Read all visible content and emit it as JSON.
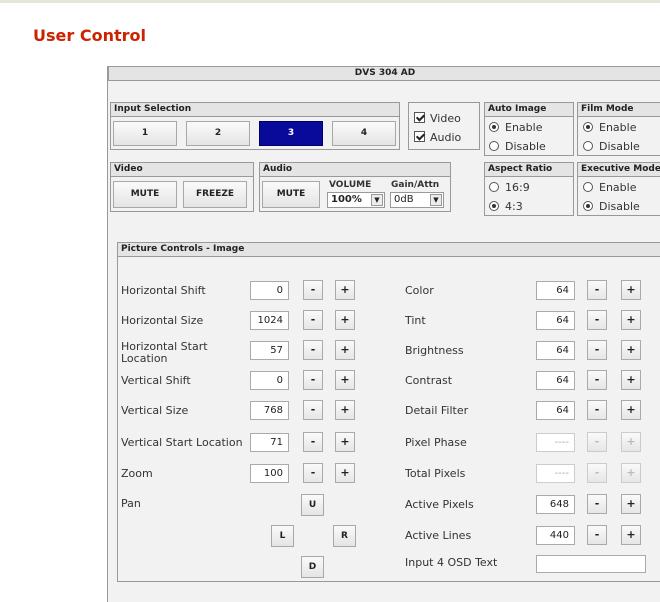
{
  "page_title": "User Control",
  "device_title": "DVS 304 AD",
  "input_selection": {
    "label": "Input Selection",
    "buttons": [
      "1",
      "2",
      "3",
      "4"
    ],
    "selected": "3",
    "video_label": "Video",
    "video_checked": true,
    "audio_label": "Audio",
    "audio_checked": true
  },
  "auto_image": {
    "label": "Auto Image",
    "enable": "Enable",
    "disable": "Disable",
    "value": "Enable"
  },
  "film_mode": {
    "label": "Film Mode",
    "enable": "Enable",
    "disable": "Disable",
    "value": "Enable"
  },
  "aspect_ratio": {
    "label": "Aspect Ratio",
    "opt1": "16:9",
    "opt2": "4:3",
    "value": "4:3"
  },
  "executive_mode": {
    "label": "Executive Mode",
    "enable": "Enable",
    "disable": "Disable",
    "value": "Disable"
  },
  "video_box": {
    "label": "Video",
    "mute": "MUTE",
    "freeze": "FREEZE"
  },
  "audio_box": {
    "label": "Audio",
    "mute": "MUTE",
    "volume_label": "VOLUME",
    "volume_value": "100%",
    "gain_label": "Gain/Attn",
    "gain_value": "0dB"
  },
  "picture_controls": {
    "label": "Picture Controls - Image",
    "minus": "-",
    "plus": "+",
    "left": [
      {
        "label": "Horizontal Shift",
        "value": "0"
      },
      {
        "label": "Horizontal Size",
        "value": "1024"
      },
      {
        "label": "Horizontal Start Location",
        "value": "57"
      },
      {
        "label": "Vertical Shift",
        "value": "0"
      },
      {
        "label": "Vertical Size",
        "value": "768"
      },
      {
        "label": "Vertical Start Location",
        "value": "71"
      },
      {
        "label": "Zoom",
        "value": "100"
      }
    ],
    "pan": {
      "label": "Pan",
      "up": "U",
      "left": "L",
      "right": "R",
      "down": "D"
    },
    "right": [
      {
        "label": "Color",
        "value": "64",
        "disabled": false
      },
      {
        "label": "Tint",
        "value": "64",
        "disabled": false
      },
      {
        "label": "Brightness",
        "value": "64",
        "disabled": false
      },
      {
        "label": "Contrast",
        "value": "64",
        "disabled": false
      },
      {
        "label": "Detail Filter",
        "value": "64",
        "disabled": false
      },
      {
        "label": "Pixel Phase",
        "value": "----",
        "disabled": true
      },
      {
        "label": "Total Pixels",
        "value": "----",
        "disabled": true
      },
      {
        "label": "Active Pixels",
        "value": "648",
        "disabled": false
      },
      {
        "label": "Active Lines",
        "value": "440",
        "disabled": false
      }
    ],
    "osd_label": "Input 4 OSD Text",
    "osd_value": ""
  }
}
